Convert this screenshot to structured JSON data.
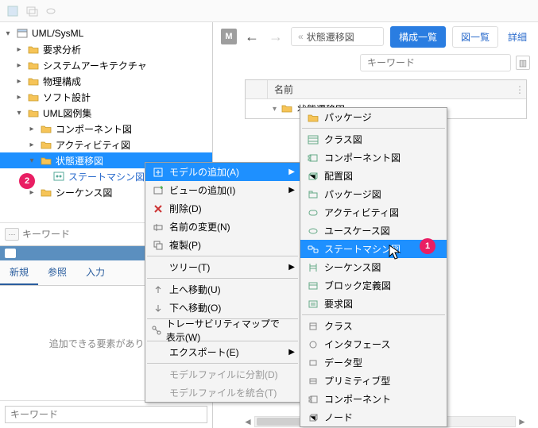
{
  "toolbar": {},
  "tree": {
    "root": "UML/SysML",
    "items": [
      {
        "label": "要求分析"
      },
      {
        "label": "システムアーキテクチャ"
      },
      {
        "label": "物理構成"
      },
      {
        "label": "ソフト設計"
      },
      {
        "label": "UML図例集",
        "children": [
          {
            "label": "コンポーネント図"
          },
          {
            "label": "アクティビティ図"
          },
          {
            "label": "状態遷移図",
            "selected": true,
            "children": [
              {
                "label": "ステートマシン図",
                "diagram": true
              },
              {
                "label": "シーケンス図"
              }
            ]
          }
        ]
      }
    ],
    "keyword_placeholder": "キーワード"
  },
  "bottom_panel": {
    "tabs": [
      "新規",
      "参照",
      "入力"
    ],
    "empty_text": "追加できる要素がありませ",
    "search_placeholder": "キーワード"
  },
  "right": {
    "badge": "M",
    "breadcrumb": "状態遷移図",
    "btn_primary": "構成一覧",
    "btn_diagram": "図一覧",
    "link_detail": "詳細",
    "search_placeholder": "キーワード",
    "table": {
      "header_name": "名前",
      "row1": "状態遷移図"
    }
  },
  "ctx1": {
    "add_model": "モデルの追加(A)",
    "add_view": "ビューの追加(I)",
    "delete": "削除(D)",
    "rename": "名前の変更(N)",
    "duplicate": "複製(P)",
    "tree": "ツリー(T)",
    "move_up": "上へ移動(U)",
    "move_down": "下へ移動(O)",
    "trace": "トレーサビリティマップで表示(W)",
    "export": "エクスポート(E)",
    "split": "モデルファイルに分割(D)",
    "merge": "モデルファイルを統合(T)"
  },
  "ctx2": {
    "package": "パッケージ",
    "class_d": "クラス図",
    "component_d": "コンポーネント図",
    "deployment_d": "配置図",
    "package_d": "パッケージ図",
    "activity_d": "アクティビティ図",
    "usecase_d": "ユースケース図",
    "statemachine_d": "ステートマシン図",
    "sequence_d": "シーケンス図",
    "blockdef_d": "ブロック定義図",
    "requirement_d": "要求図",
    "class_t": "クラス",
    "interface_t": "インタフェース",
    "datatype_t": "データ型",
    "primitive_t": "プリミティブ型",
    "component_t": "コンポーネント",
    "node_t": "ノード"
  },
  "badges": {
    "b1": "1",
    "b2": "2"
  }
}
